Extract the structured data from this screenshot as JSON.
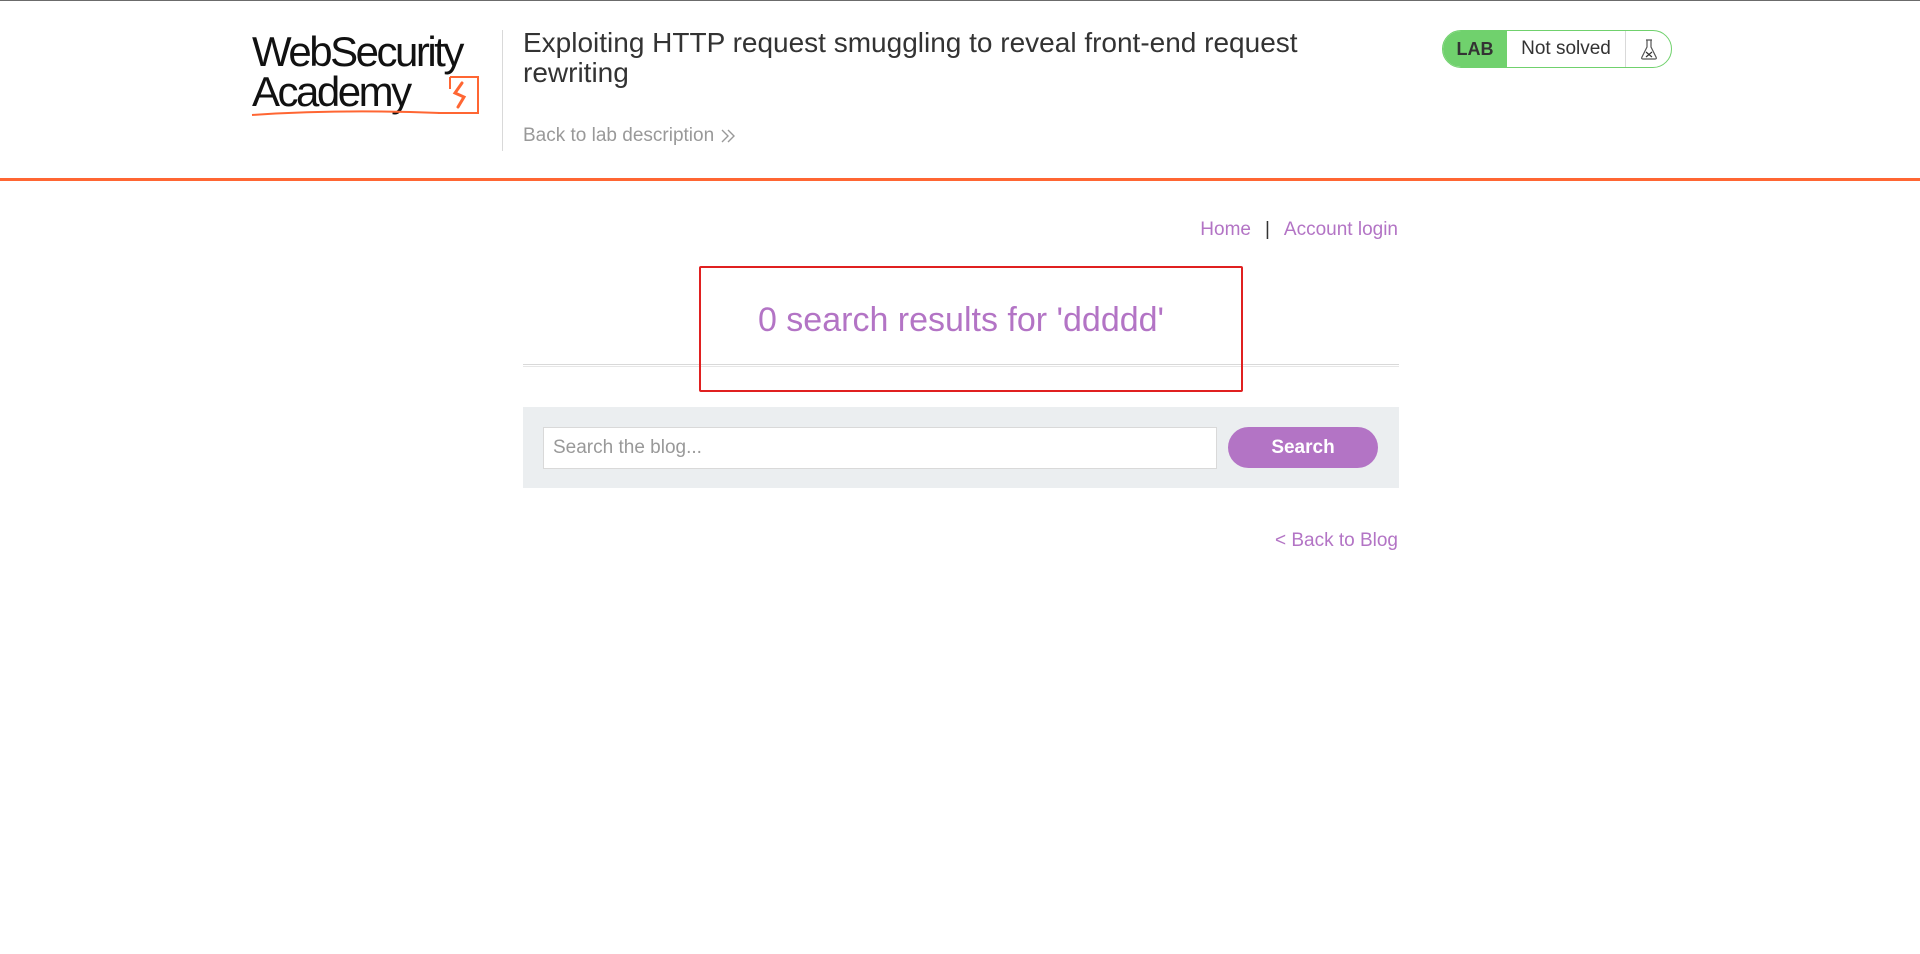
{
  "header": {
    "logo": {
      "line1": "WebSecurity",
      "line2": "Academy",
      "accent_color": "#ff6633"
    },
    "lab_title": "Exploiting HTTP request smuggling to reveal front-end request rewriting",
    "back_link": "Back to lab description",
    "back_icon": "double-chevron-right-icon",
    "status": {
      "badge": "LAB",
      "text": "Not solved",
      "icon": "flask-icon",
      "color": "#70d16d"
    }
  },
  "nav": {
    "home": "Home",
    "separator": "|",
    "account": "Account login"
  },
  "main": {
    "results_heading": "0 search results for 'ddddd'",
    "search": {
      "placeholder": "Search the blog...",
      "value": "",
      "button": "Search"
    },
    "back_to_blog": "< Back to Blog"
  },
  "colors": {
    "link": "#b374c5",
    "accent": "#ff6633",
    "annotation_box": "#e02020"
  }
}
